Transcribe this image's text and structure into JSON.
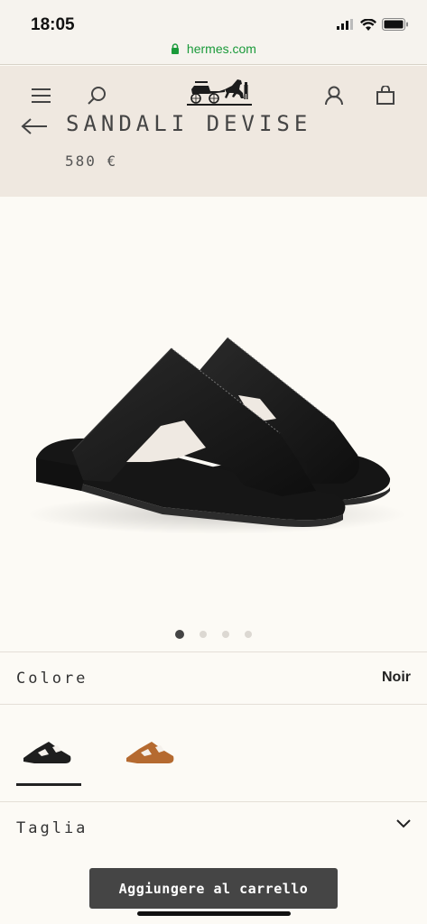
{
  "status_bar": {
    "time": "18:05",
    "icons": [
      "cellular-signal-icon",
      "wifi-icon",
      "battery-icon"
    ]
  },
  "browser": {
    "url": "hermes.com",
    "secure_icon": "lock-icon",
    "url_color": "#1a9a3a"
  },
  "header": {
    "icons": [
      "menu-icon",
      "search-icon",
      "hermes-carriage-logo",
      "account-icon",
      "bag-icon"
    ]
  },
  "product": {
    "title": "SANDALI DEVISE",
    "price": "580 €",
    "image": "black-leather-sandal",
    "carousel": {
      "total": 4,
      "current": 1
    }
  },
  "options": {
    "color_label": "Colore",
    "color_value": "Noir",
    "swatches": [
      {
        "name": "Noir",
        "color": "#1e1e1e",
        "selected": true
      },
      {
        "name": "Gold",
        "color": "#b56a30",
        "selected": false
      }
    ],
    "size_label": "Taglia"
  },
  "actions": {
    "add_to_cart": "Aggiungere al carrello"
  },
  "colors": {
    "background": "#fcfaf5",
    "header_bg": "#efe8e0",
    "button_bg": "#454545"
  }
}
